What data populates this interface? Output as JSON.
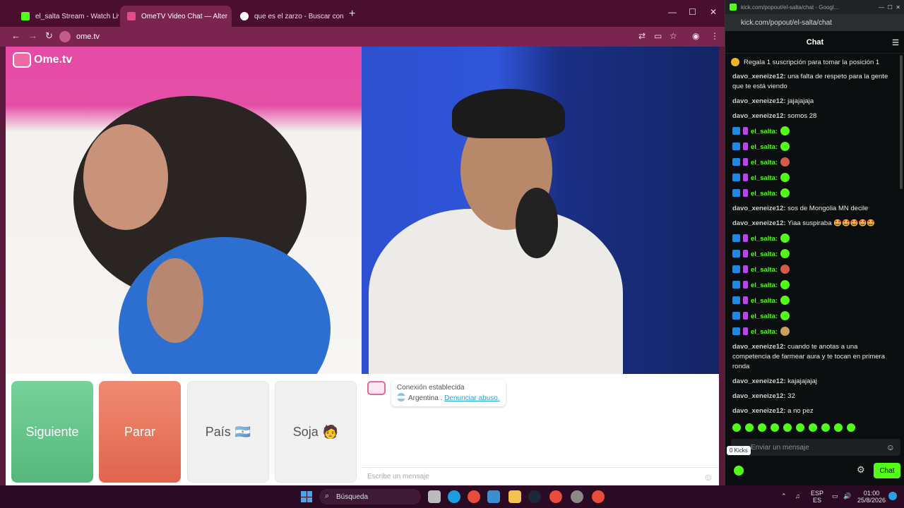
{
  "browser": {
    "tabs": [
      {
        "title": "el_salta Stream - Watch Live on",
        "favicon_color": "#53fc18"
      },
      {
        "title": "OmeTV Video Chat — Alter",
        "favicon_color": "#e44b8b"
      },
      {
        "title": "que es el zarzo - Buscar con Go",
        "favicon_color": "#ffffff"
      }
    ],
    "new_tab": "+",
    "window_controls": {
      "minimize": "—",
      "maximize": "☐",
      "close": "✕"
    },
    "nav": {
      "back": "←",
      "forward": "→",
      "reload": "↻"
    },
    "url": "ome.tv"
  },
  "ometv": {
    "logo": "Ome.tv",
    "buttons": {
      "next": "Siguiente",
      "stop": "Parar",
      "country": "País",
      "country_emoji": "🇦🇷",
      "gender": "Soja",
      "gender_emoji": "🧑"
    },
    "system_message": {
      "status": "Conexión establecida",
      "country": "Argentina",
      "separator": " . ",
      "report": "Denunciar abuso."
    },
    "message_placeholder": "Escribe un mensaje"
  },
  "kick": {
    "window_title": "kick.com/popout/el-salta/chat - Googl...",
    "url": "kick.com/popout/el-salta/chat",
    "header": "Chat",
    "pinned": "Regala 1 suscripción para tomar la posición 1",
    "messages": [
      {
        "user": "davo_xeneize12:",
        "text": "una falta de respeto para la gente que te está viendo"
      },
      {
        "user": "davo_xeneize12:",
        "text": "jajajajaja"
      },
      {
        "user": "davo_xeneize12:",
        "text": "somos 28"
      },
      {
        "user": "el_salta:",
        "text": "",
        "badges": true,
        "emote": "green"
      },
      {
        "user": "el_salta:",
        "text": "",
        "badges": true,
        "emote": "green"
      },
      {
        "user": "el_salta:",
        "text": "",
        "badges": true,
        "emote": "red"
      },
      {
        "user": "el_salta:",
        "text": "",
        "badges": true,
        "emote": "green"
      },
      {
        "user": "el_salta:",
        "text": "",
        "badges": true,
        "emote": "green"
      },
      {
        "user": "davo_xeneize12:",
        "text": "sos de Mongolia MN decile"
      },
      {
        "user": "davo_xeneize12:",
        "text": "Yiaa suspiraba 🤩🤩🤩🤩🤩"
      },
      {
        "user": "el_salta:",
        "text": "",
        "badges": true,
        "emote": "green"
      },
      {
        "user": "el_salta:",
        "text": "",
        "badges": true,
        "emote": "green"
      },
      {
        "user": "el_salta:",
        "text": "",
        "badges": true,
        "emote": "red"
      },
      {
        "user": "el_salta:",
        "text": "",
        "badges": true,
        "emote": "green"
      },
      {
        "user": "el_salta:",
        "text": "",
        "badges": true,
        "emote": "green"
      },
      {
        "user": "el_salta:",
        "text": "",
        "badges": true,
        "emote": "green"
      },
      {
        "user": "el_salta:",
        "text": "",
        "badges": true,
        "emote": "tan"
      },
      {
        "user": "davo_xeneize12:",
        "text": "cuando te anotas a una competencia de farmear aura y te tocan en primera ronda"
      },
      {
        "user": "davo_xeneize12:",
        "text": "kajajajajaj"
      },
      {
        "user": "davo_xeneize12:",
        "text": "32"
      },
      {
        "user": "davo_xeneize12:",
        "text": "a no pez"
      }
    ],
    "input_placeholder": "Enviar un mensaje",
    "tooltip": "0 Kicks",
    "chat_button": "Chat",
    "accent": "#53fc18"
  },
  "taskbar": {
    "search": "Búsqueda",
    "language": "ESP",
    "language_sub": "ES",
    "time": "01:00",
    "date": "25/8/2026"
  }
}
